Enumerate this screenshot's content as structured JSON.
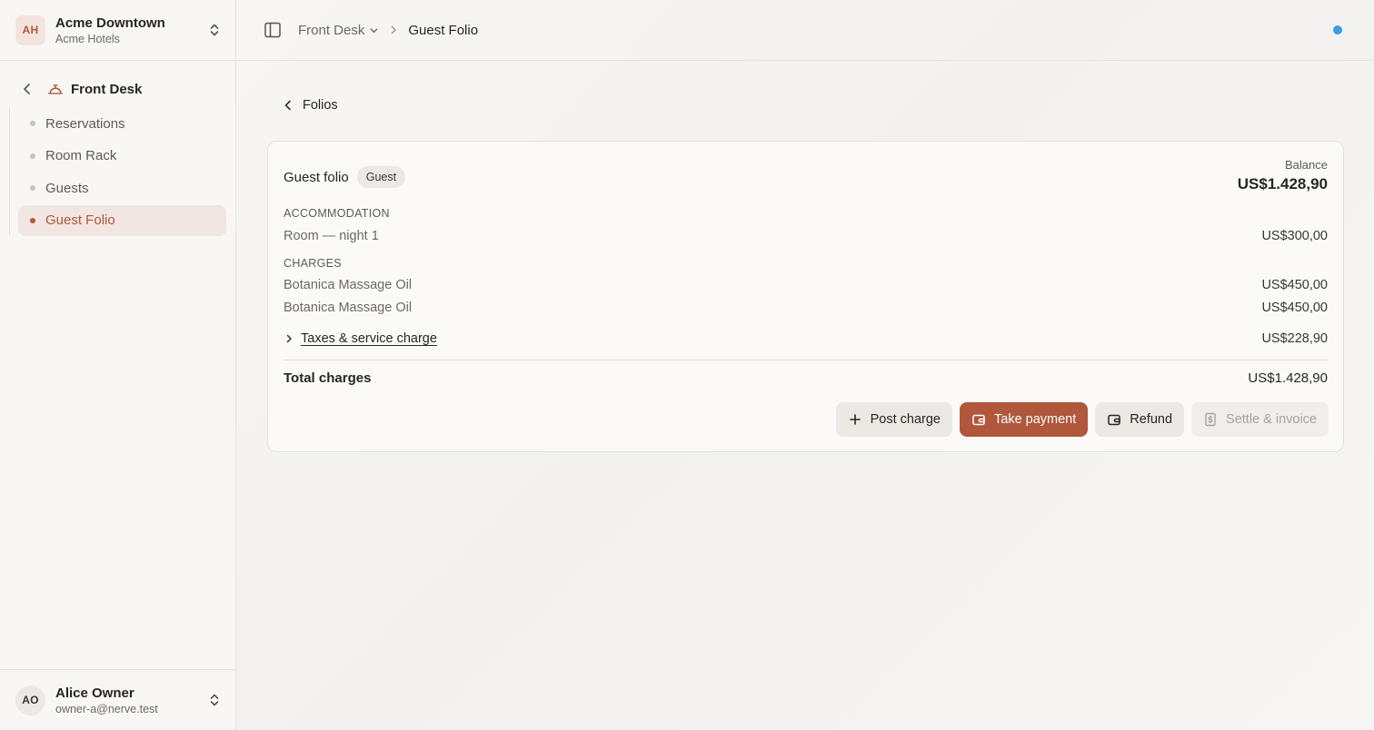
{
  "org": {
    "initials": "AH",
    "name": "Acme Downtown",
    "subtitle": "Acme Hotels"
  },
  "section": {
    "title": "Front Desk"
  },
  "nav": {
    "items": [
      {
        "label": "Reservations"
      },
      {
        "label": "Room Rack"
      },
      {
        "label": "Guests"
      },
      {
        "label": "Guest Folio"
      }
    ]
  },
  "user": {
    "initials": "AO",
    "name": "Alice Owner",
    "email": "owner-a@nerve.test"
  },
  "topbar": {
    "crumb_parent": "Front Desk",
    "crumb_current": "Guest Folio"
  },
  "back": {
    "label": "Folios"
  },
  "folio": {
    "title": "Guest folio",
    "badge": "Guest",
    "balance_label": "Balance",
    "balance_value": "US$1.428,90",
    "accommodation_label": "ACCOMMODATION",
    "accommodation": [
      {
        "desc": "Room — night 1",
        "amount": "US$300,00"
      }
    ],
    "charges_label": "CHARGES",
    "charges": [
      {
        "desc": "Botanica Massage Oil",
        "amount": "US$450,00"
      },
      {
        "desc": "Botanica Massage Oil",
        "amount": "US$450,00"
      }
    ],
    "taxes": {
      "label": "Taxes & service charge",
      "amount": "US$228,90"
    },
    "total": {
      "label": "Total charges",
      "amount": "US$1.428,90"
    }
  },
  "actions": {
    "post_charge": "Post charge",
    "take_payment": "Take payment",
    "refund": "Refund",
    "settle": "Settle & invoice"
  },
  "colors": {
    "accent": "#b0573c",
    "status": "#3b9ce6"
  }
}
